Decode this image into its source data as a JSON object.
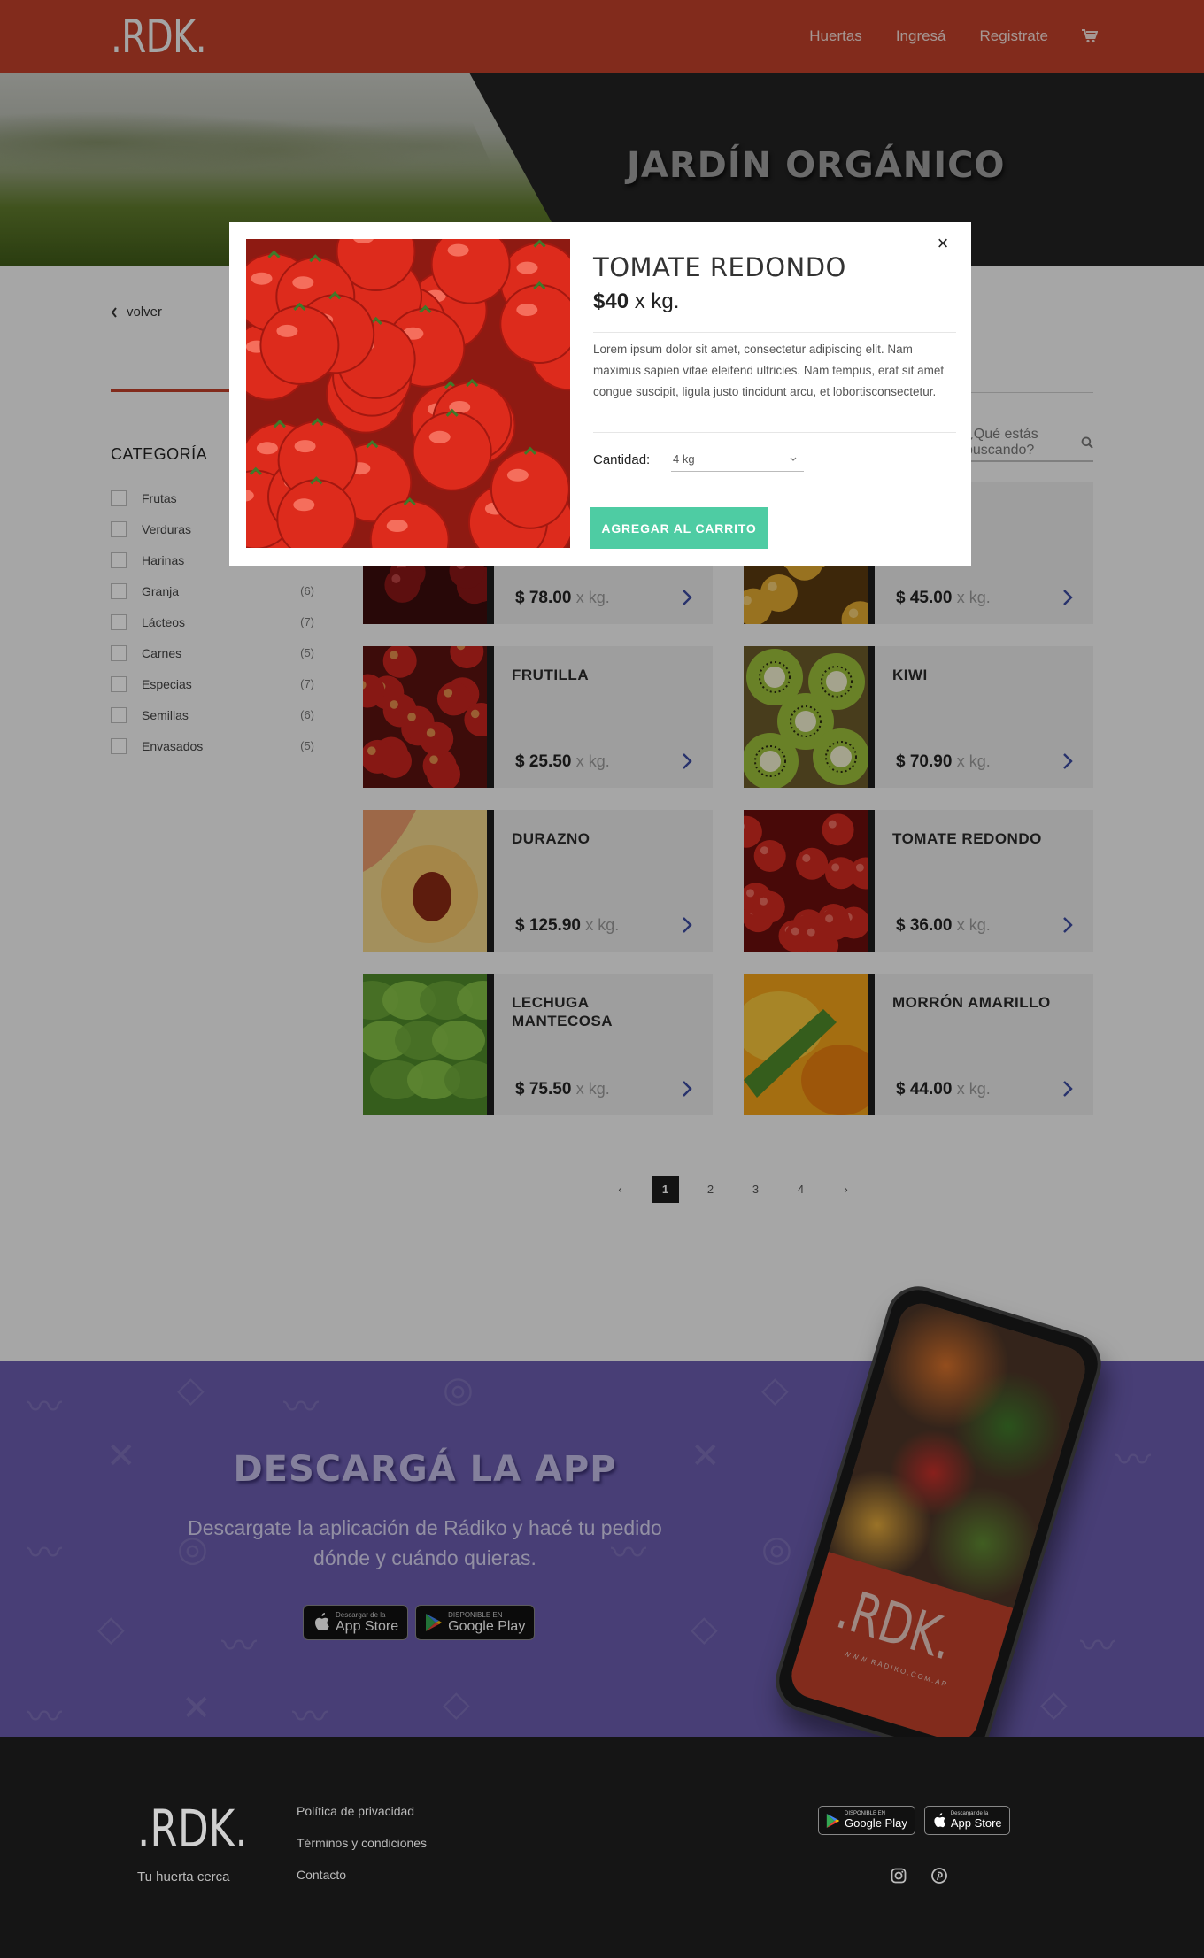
{
  "nav": {
    "logo": ".RDK.",
    "links": [
      "Huertas",
      "Ingresá",
      "Registrate"
    ]
  },
  "hero": {
    "title": "JARDÍN ORGÁNICO"
  },
  "page": {
    "back_label": "volver",
    "search_placeholder": "¿Qué estás buscando?"
  },
  "categories": {
    "title": "CATEGORÍA",
    "items": [
      {
        "label": "Frutas",
        "count": ""
      },
      {
        "label": "Verduras",
        "count": ""
      },
      {
        "label": "Harinas",
        "count": ""
      },
      {
        "label": "Granja",
        "count": "(6)"
      },
      {
        "label": "Lácteos",
        "count": "(7)"
      },
      {
        "label": "Carnes",
        "count": "(5)"
      },
      {
        "label": "Especias",
        "count": "(7)"
      },
      {
        "label": "Semillas",
        "count": "(6)"
      },
      {
        "label": "Envasados",
        "count": "(5)"
      }
    ]
  },
  "products": [
    {
      "name": "",
      "price": "$ 78.00",
      "unit": "x kg.",
      "img": "cherry"
    },
    {
      "name": "",
      "price": "$ 45.00",
      "unit": "x kg.",
      "img": "orange"
    },
    {
      "name": "FRUTILLA",
      "price": "$ 25.50",
      "unit": "x kg.",
      "img": "strawberry"
    },
    {
      "name": "KIWI",
      "price": "$ 70.90",
      "unit": "x kg.",
      "img": "kiwi"
    },
    {
      "name": "DURAZNO",
      "price": "$ 125.90",
      "unit": "x kg.",
      "img": "peach"
    },
    {
      "name": "TOMATE REDONDO",
      "price": "$ 36.00",
      "unit": "x kg.",
      "img": "tomato"
    },
    {
      "name": "LECHUGA MANTECOSA",
      "price": "$ 75.50",
      "unit": "x kg.",
      "img": "lettuce"
    },
    {
      "name": "MORRÓN AMARILLO",
      "price": "$ 44.00",
      "unit": "x kg.",
      "img": "pepper"
    }
  ],
  "pagination": {
    "prev": "‹",
    "pages": [
      "1",
      "2",
      "3",
      "4"
    ],
    "next": "›",
    "active": "1"
  },
  "download": {
    "title": "DESCARGÁ LA APP",
    "subtitle_line1": "Descargate la aplicación de Rádiko y hacé tu pedido",
    "subtitle_line2": "dónde y cuándo quieras.",
    "appstore_small": "Descargar de la",
    "appstore_big": "App Store",
    "googleplay_small": "DISPONIBLE EN",
    "googleplay_big": "Google Play",
    "phone_logo": ".RDK.",
    "phone_url": "WWW.RADIKO.COM.AR"
  },
  "footer": {
    "logo": ".RDK.",
    "tagline": "Tu huerta cerca",
    "links": [
      "Política de privacidad",
      "Términos y condiciones",
      "Contacto"
    ],
    "googleplay_small": "DISPONIBLE EN",
    "googleplay_big": "Google Play",
    "appstore_small": "Descargar de la",
    "appstore_big": "App Store"
  },
  "modal": {
    "title": "TOMATE REDONDO",
    "price": "$40",
    "unit": "x kg.",
    "description": "Lorem ipsum dolor sit amet, consectetur adipiscing elit. Nam maximus sapien vitae eleifend ultricies. Nam tempus, erat sit amet congue suscipit, ligula justo tincidunt arcu, et lobortisconsectetur.",
    "qty_label": "Cantidad:",
    "qty_value": "4 kg",
    "add_label": "AGREGAR AL CARRITO",
    "close": "×"
  },
  "colors": {
    "brand_red": "#c0402a",
    "accent_green": "#4ecca3",
    "purple": "#6a5cae",
    "dark": "#1c1c1c",
    "arrow_blue": "#3b4aa0"
  }
}
